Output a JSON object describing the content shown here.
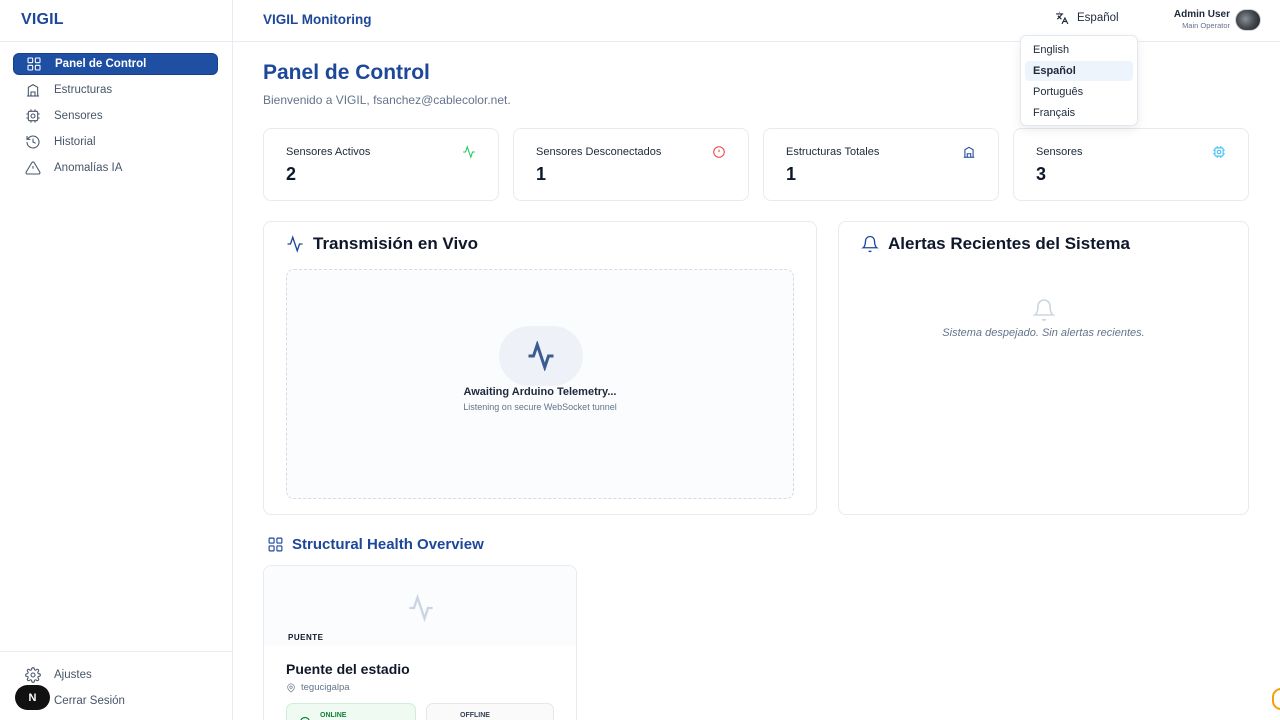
{
  "app": {
    "logo": "VIGIL",
    "header_title": "VIGIL Monitoring"
  },
  "sidebar": {
    "items": [
      {
        "label": "Panel de Control",
        "icon": "layout-grid-icon",
        "active": true
      },
      {
        "label": "Estructuras",
        "icon": "building-icon",
        "active": false
      },
      {
        "label": "Sensores",
        "icon": "cpu-icon",
        "active": false
      },
      {
        "label": "Historial",
        "icon": "history-icon",
        "active": false
      },
      {
        "label": "Anomalías IA",
        "icon": "warning-triangle-icon",
        "active": false
      }
    ],
    "settings_label": "Ajustes",
    "logout_label": "Cerrar Sesión",
    "n_badge": "N"
  },
  "header": {
    "language_label": "Español",
    "user_name": "Admin User",
    "user_role": "Main Operator"
  },
  "language_menu": {
    "options": [
      "English",
      "Español",
      "Português",
      "Français"
    ],
    "selected": "Español"
  },
  "main": {
    "title": "Panel de Control",
    "welcome": "Bienvenido a VIGIL, fsanchez@cablecolor.net.",
    "stats": [
      {
        "label": "Sensores Activos",
        "value": "2",
        "icon": "activity-icon",
        "color": "#22c55e"
      },
      {
        "label": "Sensores Desconectados",
        "value": "1",
        "icon": "alert-circle-icon",
        "color": "#ef4444"
      },
      {
        "label": "Estructuras Totales",
        "value": "1",
        "icon": "building-icon",
        "color": "#1d4799"
      },
      {
        "label": "Sensores",
        "value": "3",
        "icon": "cpu-icon",
        "color": "#38bdf8"
      }
    ],
    "live": {
      "title": "Transmisión en Vivo",
      "waiting": "Awaiting Arduino Telemetry...",
      "sub": "Listening on secure WebSocket tunnel"
    },
    "alerts": {
      "title": "Alertas Recientes del Sistema",
      "empty": "Sistema despejado. Sin alertas recientes."
    },
    "structural": {
      "title": "Structural Health Overview",
      "card": {
        "type": "PUENTE",
        "name": "Puente del estadio",
        "location": "tegucigalpa",
        "online_label": "ONLINE",
        "offline_label": "OFFLINE"
      }
    }
  },
  "colors": {
    "brand": "#1d4799",
    "active_nav": "#1e4fa3",
    "online": "#15803d"
  }
}
